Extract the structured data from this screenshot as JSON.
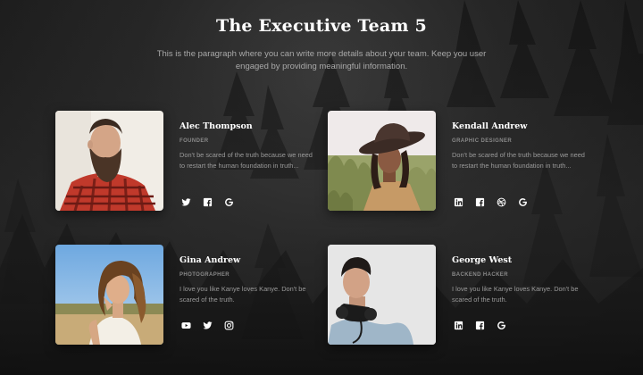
{
  "header": {
    "title": "The Executive Team 5",
    "subtitle": "This is the paragraph where you can write more details about your team. Keep you user engaged by providing meaningful information."
  },
  "team": [
    {
      "name": "Alec Thompson",
      "role": "FOUNDER",
      "description": "Don't be scared of the truth because we need to restart the human foundation in truth...",
      "socials": [
        "twitter-icon",
        "facebook-icon",
        "google-icon"
      ]
    },
    {
      "name": "Kendall Andrew",
      "role": "GRAPHIC DESIGNER",
      "description": "Don't be scared of the truth because we need to restart the human foundation in truth...",
      "socials": [
        "linkedin-icon",
        "facebook-icon",
        "dribbble-icon",
        "google-icon"
      ]
    },
    {
      "name": "Gina Andrew",
      "role": "PHOTOGRAPHER",
      "description": "I love you like Kanye loves Kanye. Don't be scared of the truth.",
      "socials": [
        "youtube-icon",
        "twitter-icon",
        "instagram-icon"
      ]
    },
    {
      "name": "George West",
      "role": "BACKEND HACKER",
      "description": "I love you like Kanye loves Kanye. Don't be scared of the truth.",
      "socials": [
        "linkedin-icon",
        "facebook-icon",
        "google-icon"
      ]
    }
  ],
  "colors": {
    "background": "#1e1e1e",
    "title": "#ffffff",
    "text_muted": "#9a9a9a"
  }
}
